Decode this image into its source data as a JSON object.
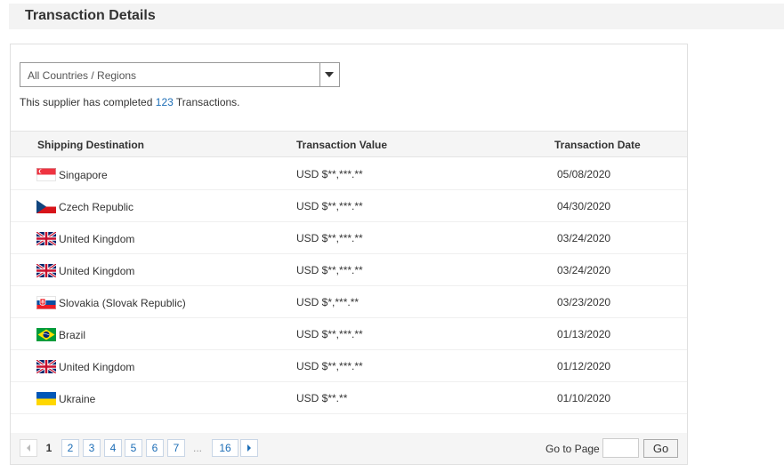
{
  "header": {
    "title": "Transaction Details"
  },
  "filter": {
    "selected": "All Countries / Regions"
  },
  "summary": {
    "prefix": "This supplier has completed",
    "count": "123",
    "suffix": "Transactions."
  },
  "table": {
    "columns": [
      "Shipping Destination",
      "Transaction Value",
      "Transaction Date"
    ],
    "rows": [
      {
        "destination": "Singapore",
        "flag": "singapore-flag",
        "value": "USD $**,***.**",
        "date": "05/08/2020"
      },
      {
        "destination": "Czech Republic",
        "flag": "czech-flag",
        "value": "USD $**,***.**",
        "date": "04/30/2020"
      },
      {
        "destination": "United Kingdom",
        "flag": "uk-flag",
        "value": "USD $**,***.**",
        "date": "03/24/2020"
      },
      {
        "destination": "United Kingdom",
        "flag": "uk-flag",
        "value": "USD $**,***.**",
        "date": "03/24/2020"
      },
      {
        "destination": "Slovakia (Slovak Republic)",
        "flag": "slovakia-flag",
        "value": "USD $*,***.**",
        "date": "03/23/2020"
      },
      {
        "destination": "Brazil",
        "flag": "brazil-flag",
        "value": "USD $**,***.**",
        "date": "01/13/2020"
      },
      {
        "destination": "United Kingdom",
        "flag": "uk-flag",
        "value": "USD $**,***.**",
        "date": "01/12/2020"
      },
      {
        "destination": "Ukraine",
        "flag": "ukraine-flag",
        "value": "USD $**.**",
        "date": "01/10/2020"
      }
    ]
  },
  "pagination": {
    "current": "1",
    "pages": [
      "2",
      "3",
      "4",
      "5",
      "6",
      "7"
    ],
    "ellipsis": "...",
    "last": "16",
    "goto_label": "Go to Page",
    "goto_value": "",
    "go_label": "Go"
  },
  "colors": {
    "link": "#1c6db6",
    "header_bg": "#f3f3f3"
  }
}
